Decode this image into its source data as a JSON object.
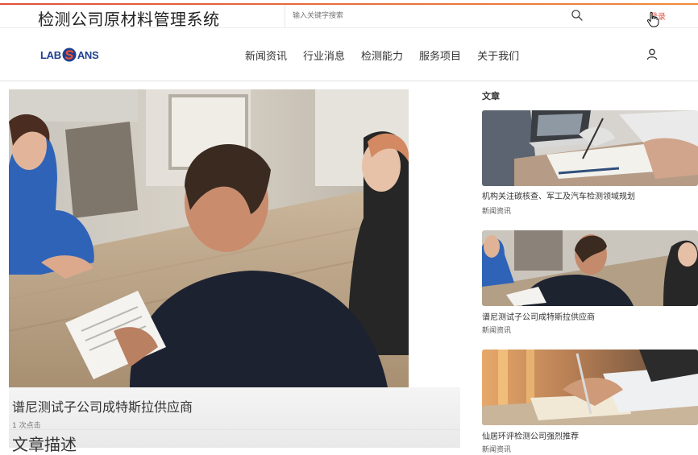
{
  "topbar": {
    "system_title": "检测公司原材料管理系统",
    "search_placeholder": "输入关键字搜索",
    "login_label": "登录"
  },
  "navbar": {
    "logo": {
      "part1": "LAB",
      "part2": "ANS",
      "mark": "S"
    },
    "items": [
      {
        "label": "新闻资讯"
      },
      {
        "label": "行业消息"
      },
      {
        "label": "检测能力"
      },
      {
        "label": "服务项目"
      },
      {
        "label": "关于我们"
      }
    ]
  },
  "hero": {
    "title": "谱尼测试子公司成特斯拉供应商",
    "clicks": "1 次点击",
    "description_heading": "文章描述"
  },
  "sidebar": {
    "heading": "文章",
    "articles": [
      {
        "title": "机构关注碳核查、军工及汽车检测领域规划",
        "category": "新闻资讯"
      },
      {
        "title": "谱尼测试子公司成特斯拉供应商",
        "category": "新闻资讯"
      },
      {
        "title": "仙居环评检测公司强烈推荐",
        "category": "新闻资讯"
      }
    ]
  },
  "colors": {
    "accent": "#e05a4a",
    "brand_blue": "#1f3f8f",
    "topline_start": "#e0503a",
    "topline_end": "#f08a3c"
  },
  "icons": [
    "search-icon",
    "user-icon",
    "cursor-hand-icon",
    "logo-s-mark"
  ]
}
